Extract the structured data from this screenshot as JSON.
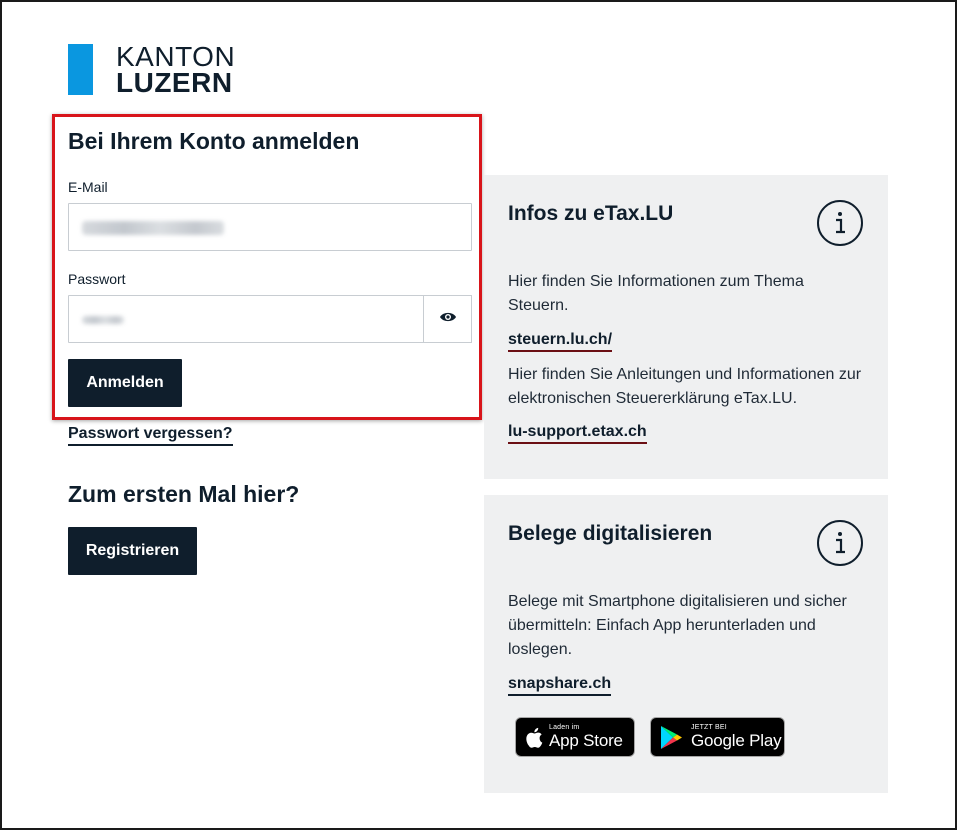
{
  "logo": {
    "line1": "KANTON",
    "line2": "LUZERN"
  },
  "login": {
    "title": "Bei Ihrem Konto anmelden",
    "email_label": "E-Mail",
    "password_label": "Passwort",
    "submit_label": "Anmelden",
    "forgot_label": "Passwort vergessen?"
  },
  "register": {
    "title": "Zum ersten Mal hier?",
    "button_label": "Registrieren"
  },
  "info_panel": {
    "title": "Infos zu eTax.LU",
    "text1": "Hier finden Sie Informationen zum Thema Steuern.",
    "link1": "steuern.lu.ch/",
    "text2": "Hier finden Sie Anleitungen und Informationen zur elektronischen Steuererklärung eTax.LU.",
    "link2": "lu-support.etax.ch"
  },
  "belege_panel": {
    "title": "Belege digitalisieren",
    "text": "Belege mit Smartphone digitalisieren und sicher übermitteln: Einfach App herunterladen und loslegen.",
    "link": "snapshare.ch",
    "app_store_small": "Laden im",
    "app_store_big": "App Store",
    "google_play_small": "JETZT BEI",
    "google_play_big": "Google Play"
  },
  "colors": {
    "brand_blue": "#0a97e0",
    "dark_navy": "#0f1e2c",
    "highlight_red": "#d8141a",
    "panel_gray": "#eff0f1"
  },
  "icons": [
    "eye-icon",
    "info-icon",
    "apple-icon",
    "google-play-icon"
  ]
}
